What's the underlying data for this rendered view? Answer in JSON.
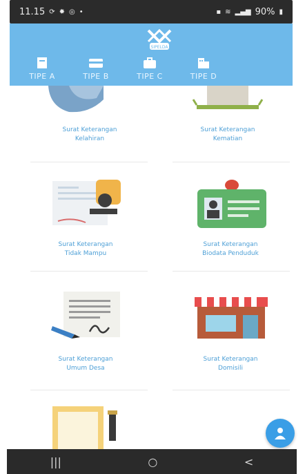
{
  "status_bar": {
    "time": "11.15",
    "left_icons": [
      "sync-icon",
      "gear-icon",
      "circle-icon"
    ],
    "battery": "90%"
  },
  "header": {
    "logo_text": "SIPELDA",
    "tabs": [
      {
        "label": "TIPE A",
        "icon": "document-icon"
      },
      {
        "label": "TIPE B",
        "icon": "card-icon"
      },
      {
        "label": "TIPE C",
        "icon": "briefcase-icon"
      },
      {
        "label": "TIPE D",
        "icon": "building-icon"
      }
    ]
  },
  "cards": [
    {
      "line1": "Surat Keterangan",
      "line2": "Kelahiran",
      "icon": "baby-icon"
    },
    {
      "line1": "Surat Keterangan",
      "line2": "Kematian",
      "icon": "grave-icon"
    },
    {
      "line1": "Surat Keterangan",
      "line2": "Tidak Mampu",
      "icon": "stamp-icon"
    },
    {
      "line1": "Surat Keterangan",
      "line2": "Biodata Penduduk",
      "icon": "id-card-icon"
    },
    {
      "line1": "Surat Keterangan",
      "line2": "Umum Desa",
      "icon": "signature-icon"
    },
    {
      "line1": "Surat Keterangan",
      "line2": "Domisili",
      "icon": "shop-icon"
    },
    {
      "line1": "",
      "line2": "",
      "icon": "certificate-icon"
    }
  ],
  "fab": {
    "icon": "user-icon"
  },
  "nav": {
    "recent": "|||",
    "home": "○",
    "back": "<"
  }
}
